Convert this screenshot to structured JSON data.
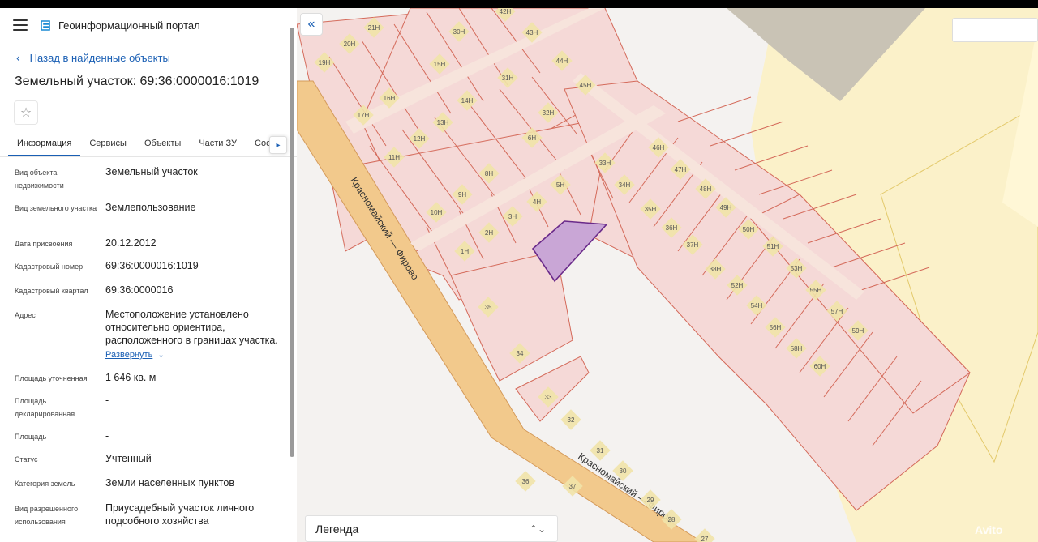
{
  "app": {
    "title": "Геоинформационный портал"
  },
  "nav": {
    "back_label": "Назад в найденные объекты"
  },
  "object": {
    "title": "Земельный участок: 69:36:0000016:1019"
  },
  "tabs": [
    {
      "label": "Информация",
      "active": true
    },
    {
      "label": "Сервисы"
    },
    {
      "label": "Объекты"
    },
    {
      "label": "Части ЗУ"
    },
    {
      "label": "Соста"
    }
  ],
  "props": [
    {
      "label": "Вид объекта недвижимости",
      "value": "Земельный участок"
    },
    {
      "label": "Вид земельного участка",
      "value": "Землепользование"
    },
    {
      "label": "Дата присвоения",
      "value": "20.12.2012"
    },
    {
      "label": "Кадастровый номер",
      "value": "69:36:0000016:1019"
    },
    {
      "label": "Кадастровый квартал",
      "value": "69:36:0000016"
    },
    {
      "label": "Адрес",
      "value": "Местоположение установлено относительно ориентира, расположенного в границах участка.",
      "expand": "Развернуть"
    },
    {
      "label": "Площадь уточненная",
      "value": "1 646 кв. м"
    },
    {
      "label": "Площадь декларированная",
      "value": "-"
    },
    {
      "label": "Площадь",
      "value": "-"
    },
    {
      "label": "Статус",
      "value": "Учтенный"
    },
    {
      "label": "Категория земель",
      "value": "Земли населенных пунктов"
    },
    {
      "label": "Вид разрешенного использования",
      "value": "Приусадебный участок личного подсобного хозяйства"
    }
  ],
  "map": {
    "road_label_1": "Красномайский — Фирово",
    "road_label_2": "Красномайский — Фиров",
    "legend_label": "Легенда",
    "parcels": [
      "42Н",
      "43Н",
      "44Н",
      "45Н",
      "21Н",
      "20Н",
      "19Н",
      "30Н",
      "15Н",
      "16Н",
      "17Н",
      "31Н",
      "14Н",
      "32Н",
      "13Н",
      "12Н",
      "6Н",
      "11Н",
      "8Н",
      "9Н",
      "10Н",
      "33Н",
      "34Н",
      "5Н",
      "4Н",
      "3Н",
      "2Н",
      "1Н",
      "35Н",
      "36Н",
      "37Н",
      "38Н",
      "46Н",
      "47Н",
      "48Н",
      "49Н",
      "50Н",
      "51Н",
      "52Н",
      "53Н",
      "54Н",
      "55Н",
      "56Н",
      "57Н",
      "58Н",
      "59Н",
      "60Н",
      "35",
      "34",
      "33",
      "32",
      "31",
      "30",
      "29",
      "28",
      "27",
      "36",
      "37"
    ],
    "watermark": "Avito",
    "colors": {
      "parcel_fill": "#f5d9d7",
      "parcel_stroke": "#d46a5a",
      "road": "#f2c98c",
      "selected": "#c9a6d6",
      "selected_stroke": "#6a2a8a",
      "field": "#fbf1c9",
      "dark_lot": "#c9c3b5"
    }
  }
}
